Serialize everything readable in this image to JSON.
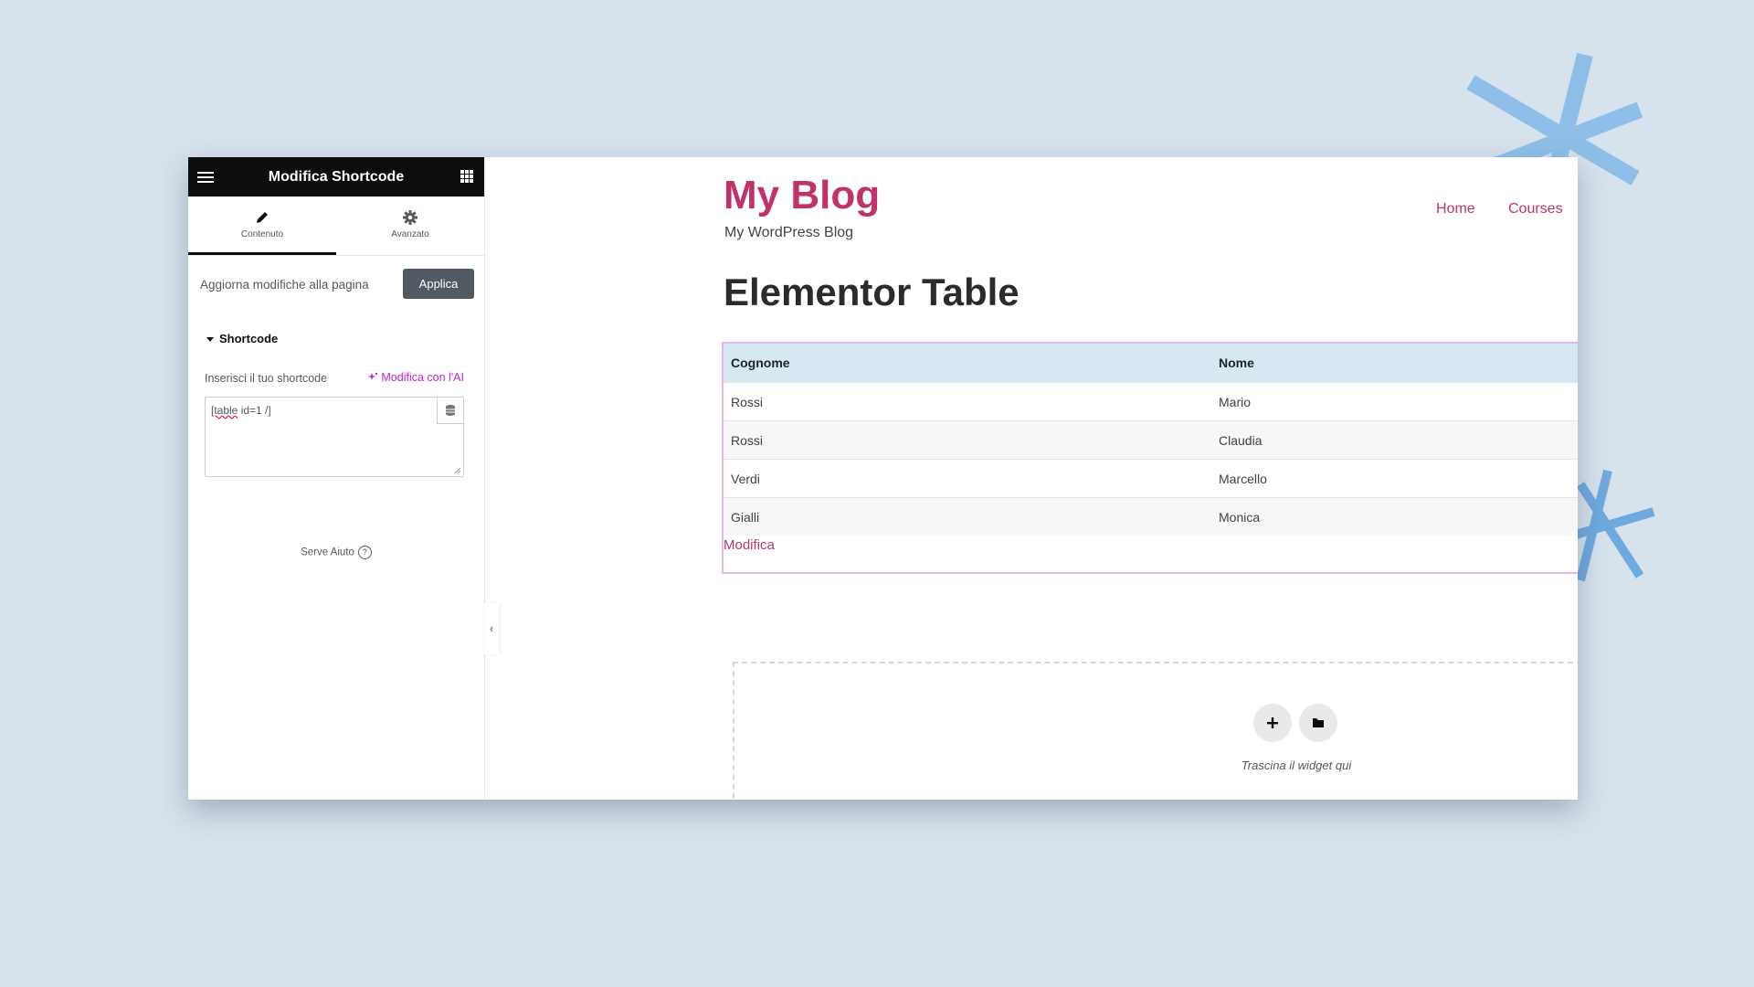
{
  "sidebar": {
    "title": "Modifica Shortcode",
    "tabs": [
      {
        "label": "Contenuto",
        "icon": "pencil-icon",
        "active": true
      },
      {
        "label": "Avanzato",
        "icon": "gear-icon",
        "active": false
      }
    ],
    "apply_label": "Aggiorna modifiche alla pagina",
    "apply_button": "Applica",
    "section_title": "Shortcode",
    "shortcode_label": "Inserisci il tuo shortcode",
    "ai_link": "Modifica con l'AI",
    "shortcode_value_part1": "[table",
    "shortcode_value_part2": " id=1 /]",
    "help_label": "Serve Aiuto",
    "help_icon": "?",
    "collapse_icon": "‹"
  },
  "site": {
    "title": "My Blog",
    "tagline": "My WordPress Blog",
    "nav": [
      "Home",
      "Courses"
    ],
    "page_title": "Elementor Table"
  },
  "table": {
    "headers": [
      "Cognome",
      "Nome"
    ],
    "rows": [
      [
        "Rossi",
        "Mario"
      ],
      [
        "Rossi",
        "Claudia"
      ],
      [
        "Verdi",
        "Marcello"
      ],
      [
        "Gialli",
        "Monica"
      ]
    ],
    "edit_link": "Modifica"
  },
  "drop_zone": {
    "text": "Trascina il widget qui",
    "buttons": [
      "plus-icon",
      "folder-icon"
    ]
  },
  "colors": {
    "accent": "#c0336a",
    "ai": "#c026d3",
    "header_bg": "#0c0d0e",
    "table_header": "#d8e8f3",
    "background": "#d6e2ec"
  }
}
